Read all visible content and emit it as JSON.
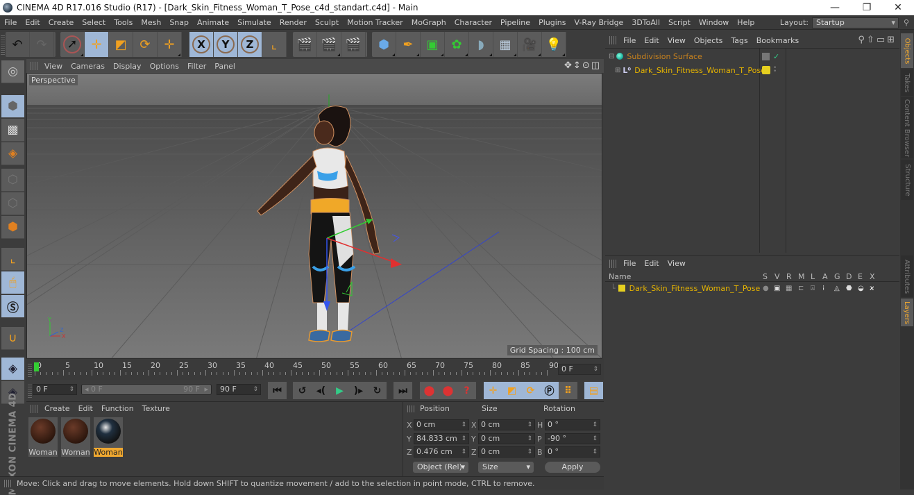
{
  "window": {
    "title": "CINEMA 4D R17.016 Studio (R17) - [Dark_Skin_Fitness_Woman_T_Pose_c4d_standart.c4d] - Main",
    "minimize": "—",
    "restore": "❐",
    "close": "✕"
  },
  "menubar": {
    "items": [
      "File",
      "Edit",
      "Create",
      "Select",
      "Tools",
      "Mesh",
      "Snap",
      "Animate",
      "Simulate",
      "Render",
      "Sculpt",
      "Motion Tracker",
      "MoGraph",
      "Character",
      "Pipeline",
      "Plugins",
      "V-Ray Bridge",
      "3DToAll",
      "Script",
      "Window",
      "Help"
    ],
    "layout_label": "Layout:",
    "layout_value": "Startup"
  },
  "toolbar": {
    "undo": "undo-icon",
    "redo": "redo-icon",
    "tools": [
      {
        "name": "live-selection",
        "glyph": "➚",
        "active": false
      },
      {
        "name": "move",
        "glyph": "✛",
        "active": true
      },
      {
        "name": "scale",
        "glyph": "◩",
        "active": false
      },
      {
        "name": "rotate",
        "glyph": "⟳",
        "active": false
      },
      {
        "name": "recent-tools",
        "glyph": "✛",
        "active": false
      }
    ],
    "axes": [
      "X",
      "Y",
      "Z"
    ],
    "coord_system": "world-coordinates",
    "render": [
      "render-view",
      "render-picture-viewer",
      "render-settings"
    ],
    "objects": [
      {
        "name": "cube",
        "glyph": "⬢"
      },
      {
        "name": "pen-spline",
        "glyph": "✒"
      },
      {
        "name": "subdivision-surface",
        "glyph": "▣"
      },
      {
        "name": "cloner",
        "glyph": "✿"
      },
      {
        "name": "deformer",
        "glyph": "◗"
      },
      {
        "name": "floor",
        "glyph": "▦"
      },
      {
        "name": "camera",
        "glyph": "🎥"
      },
      {
        "name": "light",
        "glyph": "💡"
      }
    ]
  },
  "viewport": {
    "menu": [
      "View",
      "Cameras",
      "Display",
      "Options",
      "Filter",
      "Panel"
    ],
    "camera_label": "Perspective",
    "grid_spacing": "Grid Spacing : 100 cm"
  },
  "timeline": {
    "ticks": [
      "0",
      "5",
      "10",
      "15",
      "20",
      "25",
      "30",
      "35",
      "40",
      "45",
      "50",
      "55",
      "60",
      "65",
      "70",
      "75",
      "80",
      "85",
      "90"
    ],
    "current_frame": "0 F",
    "start_field": "0 F",
    "range_start": "0 F",
    "range_end": "90 F",
    "end_field": "90 F"
  },
  "materials": {
    "menu": [
      "Create",
      "Edit",
      "Function",
      "Texture"
    ],
    "items": [
      {
        "label": "Woman",
        "selected": false
      },
      {
        "label": "Woman",
        "selected": false
      },
      {
        "label": "Woman",
        "selected": true
      }
    ]
  },
  "coordinates": {
    "headers": [
      "Position",
      "Size",
      "Rotation"
    ],
    "position": {
      "X": "0 cm",
      "Y": "84.833 cm",
      "Z": "0.476 cm"
    },
    "size": {
      "X": "0 cm",
      "Y": "0 cm",
      "Z": "0 cm"
    },
    "rotation": {
      "H": "0 °",
      "P": "-90 °",
      "B": "0 °"
    },
    "mode": "Object (Rel)",
    "size_mode": "Size",
    "apply": "Apply"
  },
  "status": {
    "text": "Move: Click and drag to move elements. Hold down SHIFT to quantize movement / add to the selection in point mode, CTRL to remove."
  },
  "object_manager": {
    "menu": [
      "File",
      "Edit",
      "View",
      "Objects",
      "Tags",
      "Bookmarks"
    ],
    "objects": [
      {
        "name": "Subdivision Surface",
        "color": "#c8821e"
      },
      {
        "name": "Dark_Skin_Fitness_Woman_T_Pose",
        "color": "#e6b400"
      }
    ]
  },
  "layer_manager": {
    "menu": [
      "File",
      "Edit",
      "View"
    ],
    "columns": [
      "Name",
      "S",
      "V",
      "R",
      "M",
      "L",
      "A",
      "G",
      "D",
      "E",
      "X"
    ],
    "layers": [
      {
        "name": "Dark_Skin_Fitness_Woman_T_Pose",
        "color": "#e6d020"
      }
    ]
  },
  "right_tabs": {
    "top": [
      {
        "label": "Objects",
        "active": true
      },
      {
        "label": "Takes",
        "active": false
      },
      {
        "label": "Content Browser",
        "active": false
      },
      {
        "label": "Structure",
        "active": false
      }
    ],
    "bottom": [
      {
        "label": "Attributes",
        "active": false
      },
      {
        "label": "Layers",
        "active": true
      }
    ]
  },
  "colors": {
    "accent": "#f0a830",
    "active_tool": "#9fb7d6",
    "panel_bg": "#3c3c3c"
  }
}
